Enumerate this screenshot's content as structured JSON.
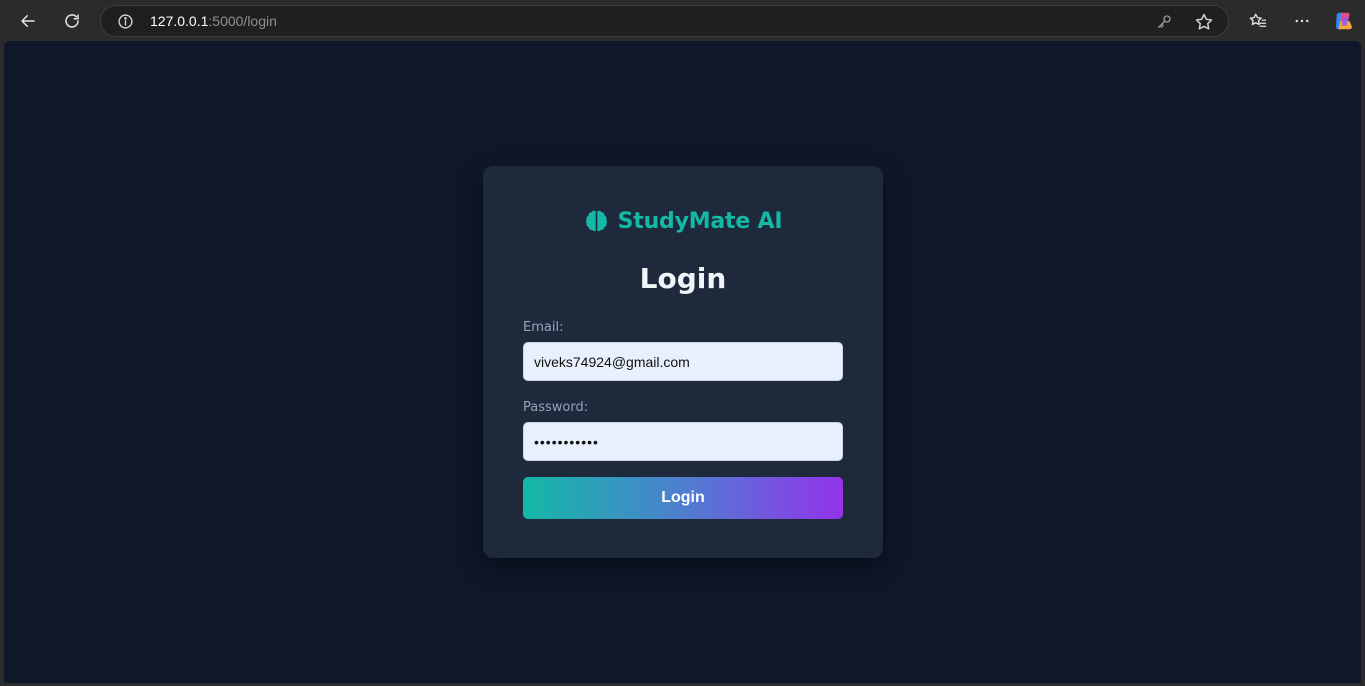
{
  "browser": {
    "url_host": "127.0.0.1",
    "url_path": ":5000/login",
    "icons": {
      "back": "arrow-left-icon",
      "reload": "reload-icon",
      "site_info": "info-icon",
      "password": "key-icon",
      "favorite": "star-icon",
      "favorites_list": "favorites-icon",
      "menu": "more-icon",
      "copilot": "copilot-icon"
    }
  },
  "page": {
    "background": "#0f172a",
    "card_background": "#1e293b",
    "accent": "#14b8a6",
    "brand_icon": "brain-icon",
    "brand_name": "StudyMate AI",
    "title": "Login",
    "email": {
      "label": "Email:",
      "value": "viveks74924@gmail.com"
    },
    "password": {
      "label": "Password:",
      "value": "•••••••••••"
    },
    "submit_label": "Login",
    "button_gradient": [
      "#14b8a6",
      "#9333ea"
    ]
  }
}
